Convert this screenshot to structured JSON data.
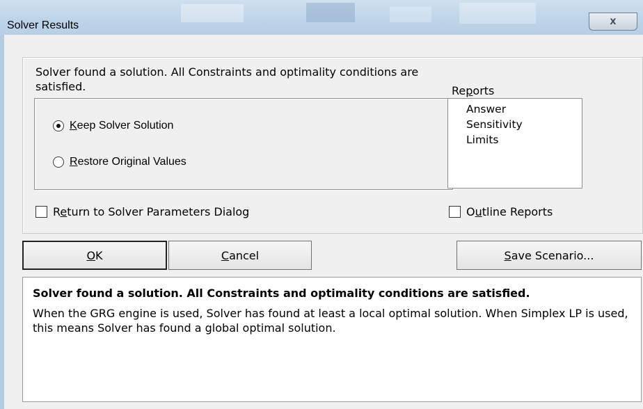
{
  "window": {
    "title": "Solver Results",
    "close_glyph": "x"
  },
  "main": {
    "message": "Solver found a solution.  All Constraints and optimality conditions are satisfied.",
    "options": [
      {
        "label": "Keep Solver Solution",
        "accel": "K",
        "rest": "eep Solver Solution",
        "selected": true
      },
      {
        "label": "Restore Original Values",
        "accel": "R",
        "rest": "estore Original Values",
        "selected": false
      }
    ],
    "return_checkbox": {
      "pre": "R",
      "accel": "e",
      "post": "turn to Solver Parameters Dialog",
      "checked": false
    },
    "reports": {
      "label_pre": "Re",
      "label_accel": "p",
      "label_post": "orts",
      "items": [
        "Answer",
        "Sensitivity",
        "Limits"
      ]
    },
    "outline_checkbox": {
      "pre": "O",
      "accel": "u",
      "post": "tline Reports",
      "checked": false
    }
  },
  "buttons": {
    "ok": {
      "accel": "O",
      "rest": "K"
    },
    "cancel": {
      "accel": "C",
      "rest": "ancel"
    },
    "save_scenario": {
      "accel": "S",
      "rest": "ave Scenario..."
    }
  },
  "info": {
    "title": "Solver found a solution.  All Constraints and optimality conditions are satisfied.",
    "body": "When the GRG engine is used, Solver has found at least a local optimal solution. When Simplex LP is used, this means Solver has found a global optimal solution."
  }
}
